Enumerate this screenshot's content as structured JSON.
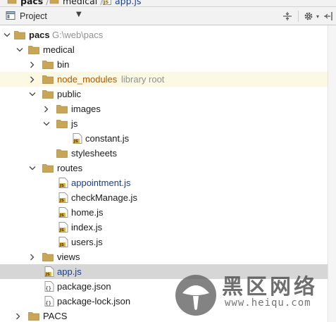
{
  "breadcrumb": {
    "items": [
      {
        "label": "pacs",
        "icon": "folder-icon"
      },
      {
        "label": "medical",
        "icon": "folder-icon"
      },
      {
        "label": "app.js",
        "icon": "js-file-icon"
      }
    ]
  },
  "toolbar": {
    "view_label": "Project",
    "buttons": [
      "collapse-all-icon",
      "gear-icon",
      "hide-panel-icon"
    ]
  },
  "tree": {
    "root": {
      "label": "pacs",
      "path": "G:\\web\\pacs"
    },
    "medical": {
      "label": "medical"
    },
    "bin": {
      "label": "bin"
    },
    "node_modules": {
      "label": "node_modules",
      "hint": "library root"
    },
    "public": {
      "label": "public"
    },
    "images": {
      "label": "images"
    },
    "js": {
      "label": "js"
    },
    "constant_js": {
      "label": "constant.js"
    },
    "stylesheets": {
      "label": "stylesheets"
    },
    "routes": {
      "label": "routes"
    },
    "appointment_js": {
      "label": "appointment.js"
    },
    "checkmanage_js": {
      "label": "checkManage.js"
    },
    "home_js": {
      "label": "home.js"
    },
    "index_js": {
      "label": "index.js"
    },
    "users_js": {
      "label": "users.js"
    },
    "views": {
      "label": "views"
    },
    "app_js": {
      "label": "app.js"
    },
    "package_json": {
      "label": "package.json"
    },
    "package_lock_json": {
      "label": "package-lock.json"
    },
    "pacs_upper": {
      "label": "PACS"
    }
  },
  "watermark": {
    "chinese": "黑区网络",
    "site": "www.heiqu.com"
  },
  "colors": {
    "folder": "#c9a657",
    "js_badge": "#d8b24a",
    "modified_blue": "#1a3e8c",
    "excluded_orange": "#b35900",
    "selected_row": "#d6d6d6",
    "library_row": "#fbf8e3"
  }
}
